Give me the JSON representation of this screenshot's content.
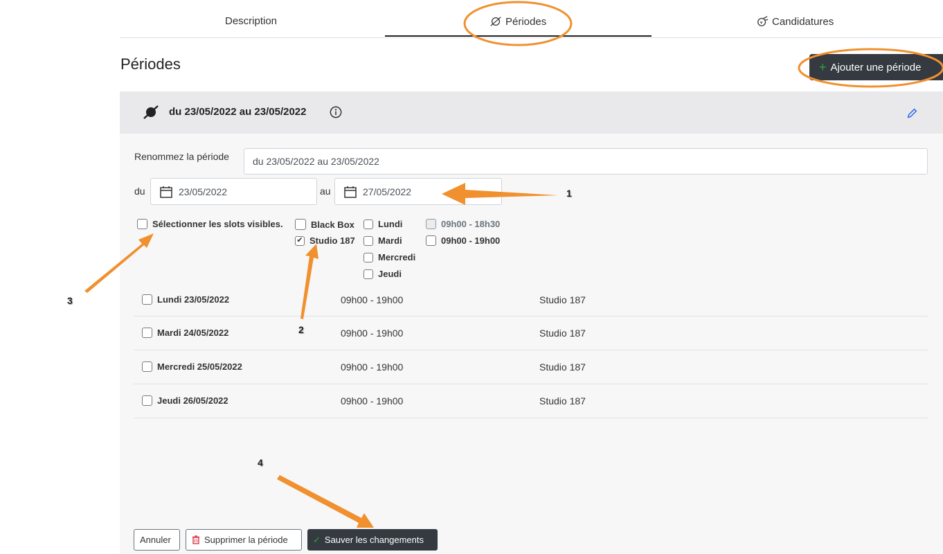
{
  "tabs": [
    {
      "label": "Description"
    },
    {
      "label": "Périodes"
    },
    {
      "label": "Candidatures"
    }
  ],
  "page_title": "Périodes",
  "add_period_label": "Ajouter une période",
  "period": {
    "title": "du 23/05/2022 au 23/05/2022",
    "rename_label": "Renommez la période",
    "rename_value": "du 23/05/2022 au 23/05/2022",
    "from_label": "du",
    "from_value": "23/05/2022",
    "to_label": "au",
    "to_value": "27/05/2022"
  },
  "filters": {
    "select_visible": "Sélectionner les slots visibles.",
    "rooms": [
      {
        "label": "Black Box",
        "checked": false
      },
      {
        "label": "Studio 187",
        "checked": true
      }
    ],
    "days": [
      "Lundi",
      "Mardi",
      "Mercredi",
      "Jeudi"
    ],
    "hours": [
      {
        "label": "09h00 - 18h30",
        "disabled": true
      },
      {
        "label": "09h00 - 19h00",
        "disabled": false
      }
    ]
  },
  "slots": [
    {
      "day": "Lundi 23/05/2022",
      "hours": "09h00 - 19h00",
      "room": "Studio 187"
    },
    {
      "day": "Mardi 24/05/2022",
      "hours": "09h00 - 19h00",
      "room": "Studio 187"
    },
    {
      "day": "Mercredi 25/05/2022",
      "hours": "09h00 - 19h00",
      "room": "Studio 187"
    },
    {
      "day": "Jeudi 26/05/2022",
      "hours": "09h00 - 19h00",
      "room": "Studio 187"
    }
  ],
  "buttons": {
    "cancel": "Annuler",
    "delete": "Supprimer la période",
    "save": "Sauver les changements"
  },
  "annotations": [
    "1",
    "2",
    "3",
    "4"
  ],
  "colors": {
    "annotation": "#f0902e",
    "accent_green": "#28a745",
    "danger": "#dc3545",
    "edit_blue": "#2563eb"
  }
}
